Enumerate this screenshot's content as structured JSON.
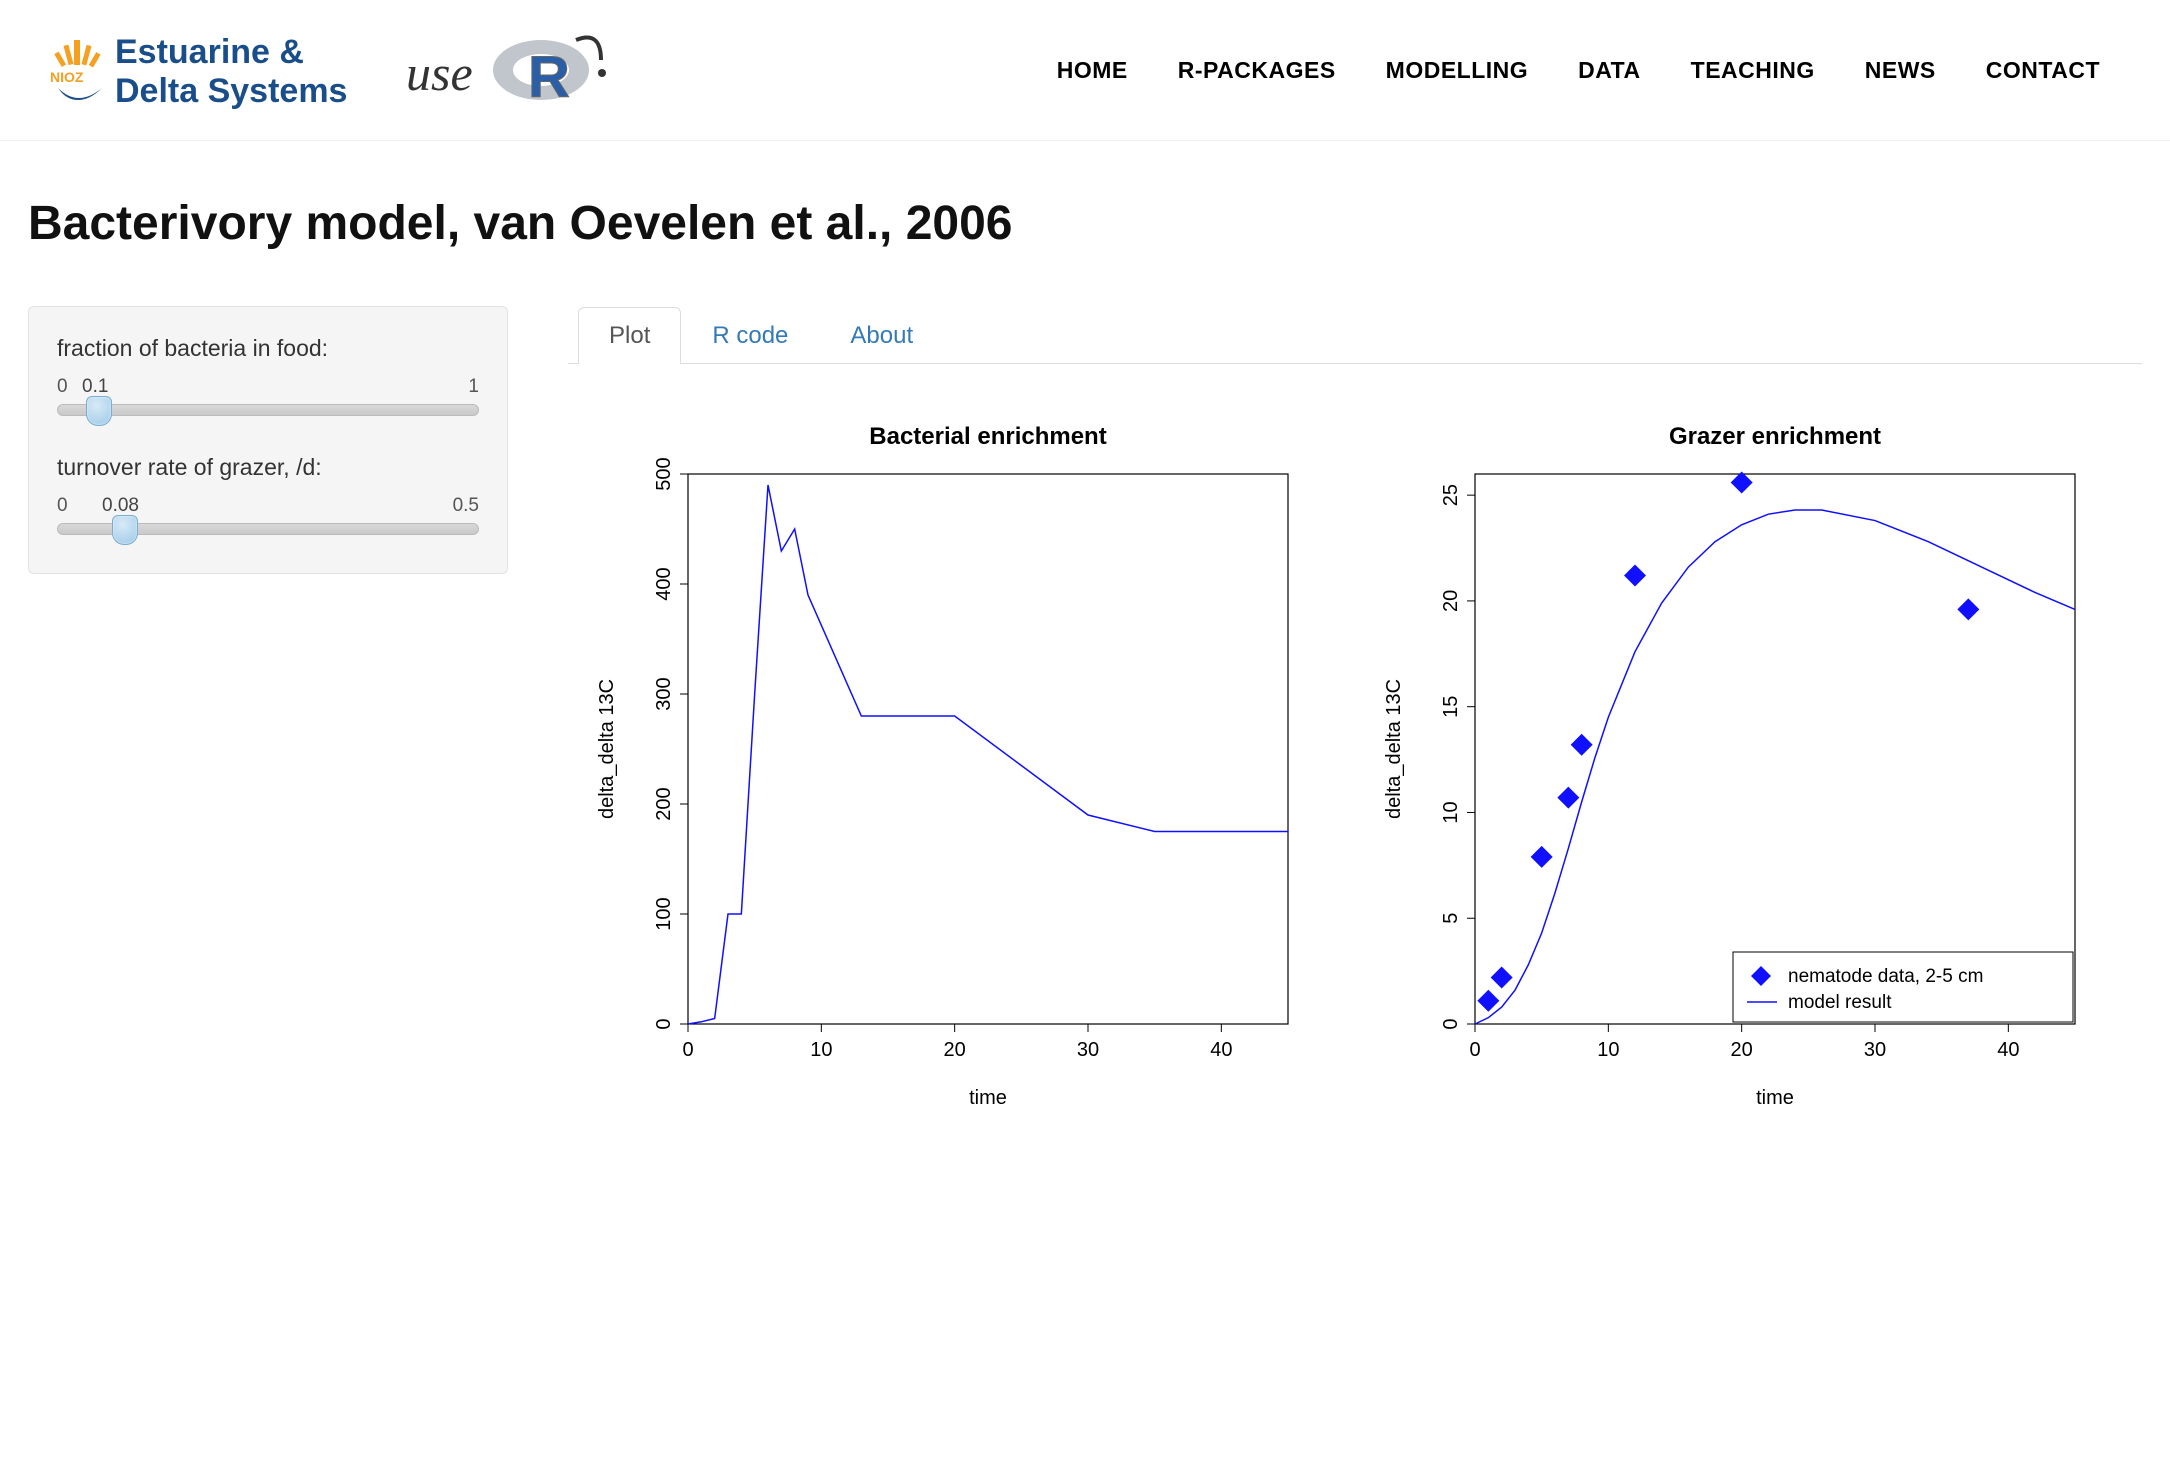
{
  "header": {
    "logo_top": "Estuarine &",
    "logo_bottom": "Delta Systems",
    "logo_nioz": "NIOZ",
    "user_text": "useR!",
    "nav": [
      "HOME",
      "R-PACKAGES",
      "MODELLING",
      "DATA",
      "TEACHING",
      "NEWS",
      "CONTACT"
    ]
  },
  "title": "Bacterivory model, van Oevelen et al., 2006",
  "sidebar": {
    "sliders": [
      {
        "label": "fraction of bacteria in food:",
        "min": "0",
        "max": "1",
        "value": "0.1",
        "frac": 0.1
      },
      {
        "label": "turnover rate of grazer, /d:",
        "min": "0",
        "max": "0.5",
        "value": "0.08",
        "frac": 0.16
      }
    ]
  },
  "tabs": [
    {
      "label": "Plot",
      "active": true
    },
    {
      "label": "R code",
      "active": false
    },
    {
      "label": "About",
      "active": false
    }
  ],
  "chart_data": [
    {
      "type": "line",
      "title": "Bacterial enrichment",
      "xlabel": "time",
      "ylabel": "delta_delta 13C",
      "xlim": [
        0,
        45
      ],
      "ylim": [
        0,
        500
      ],
      "xticks": [
        0,
        10,
        20,
        30,
        40
      ],
      "yticks": [
        0,
        100,
        200,
        300,
        400,
        500
      ],
      "series": [
        {
          "name": "model result",
          "x": [
            0,
            1,
            2,
            3,
            4,
            5,
            6,
            7,
            8,
            9,
            13,
            20,
            30,
            35,
            45
          ],
          "y": [
            0,
            2,
            5,
            100,
            100,
            300,
            490,
            430,
            450,
            390,
            280,
            280,
            190,
            175,
            175
          ]
        }
      ]
    },
    {
      "type": "line",
      "title": "Grazer enrichment",
      "xlabel": "time",
      "ylabel": "delta_delta 13C",
      "xlim": [
        0,
        45
      ],
      "ylim": [
        0,
        26
      ],
      "xticks": [
        0,
        10,
        20,
        30,
        40
      ],
      "yticks": [
        0,
        5,
        10,
        15,
        20,
        25
      ],
      "series": [
        {
          "name": "model result",
          "kind": "line",
          "x": [
            0,
            1,
            2,
            3,
            4,
            5,
            6,
            7,
            8,
            9,
            10,
            12,
            14,
            16,
            18,
            20,
            22,
            24,
            26,
            30,
            34,
            38,
            42,
            45
          ],
          "y": [
            0,
            0.3,
            0.8,
            1.6,
            2.8,
            4.3,
            6.2,
            8.3,
            10.5,
            12.6,
            14.5,
            17.6,
            19.9,
            21.6,
            22.8,
            23.6,
            24.1,
            24.3,
            24.3,
            23.8,
            22.8,
            21.6,
            20.4,
            19.6
          ]
        },
        {
          "name": "nematode data, 2-5 cm",
          "kind": "points",
          "x": [
            1,
            2,
            5,
            7,
            8,
            12,
            20,
            37
          ],
          "y": [
            1.1,
            2.2,
            7.9,
            10.7,
            13.2,
            21.2,
            25.6,
            19.6
          ]
        }
      ],
      "legend": {
        "entries": [
          "nematode data, 2-5 cm",
          "model result"
        ],
        "symbols": [
          "diamond",
          "line"
        ]
      }
    }
  ]
}
